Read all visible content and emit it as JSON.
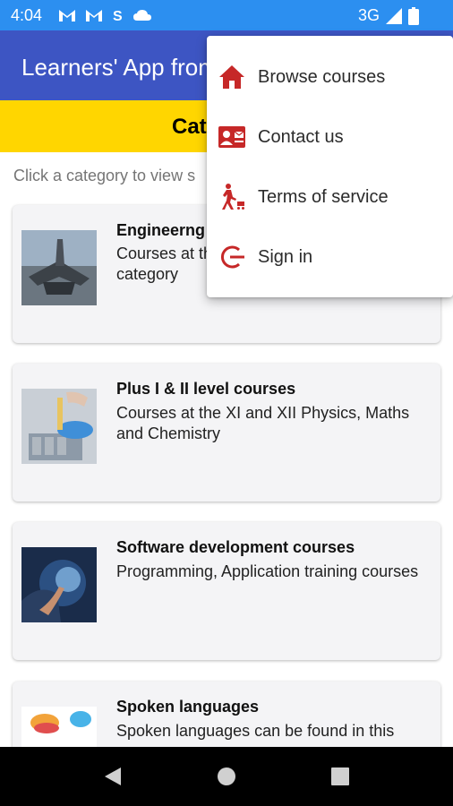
{
  "status_bar": {
    "time": "4:04",
    "network": "3G"
  },
  "app_bar": {
    "title": "Learners' App from"
  },
  "category_banner": {
    "title": "Categories"
  },
  "helper_text": "Click a category to view s",
  "categories": [
    {
      "title": "Engineerng",
      "desc": "Courses at the  level are available in this category"
    },
    {
      "title": "Plus I & II level courses",
      "desc": "Courses at the XI and XII Physics, Maths and Chemistry"
    },
    {
      "title": "Software development courses",
      "desc": "Programming, Application training courses"
    },
    {
      "title": "Spoken languages",
      "desc": "Spoken languages can be found in this"
    }
  ],
  "menu": {
    "items": [
      {
        "label": "Browse courses",
        "icon": "home-icon"
      },
      {
        "label": "Contact us",
        "icon": "contact-card-icon"
      },
      {
        "label": "Terms of service",
        "icon": "walking-cart-icon"
      },
      {
        "label": "Sign in",
        "icon": "sign-in-icon"
      }
    ]
  },
  "colors": {
    "status_bar": "#2c8ff0",
    "app_bar": "#3d55c3",
    "banner": "#ffd600",
    "menu_icon": "#c62828"
  }
}
